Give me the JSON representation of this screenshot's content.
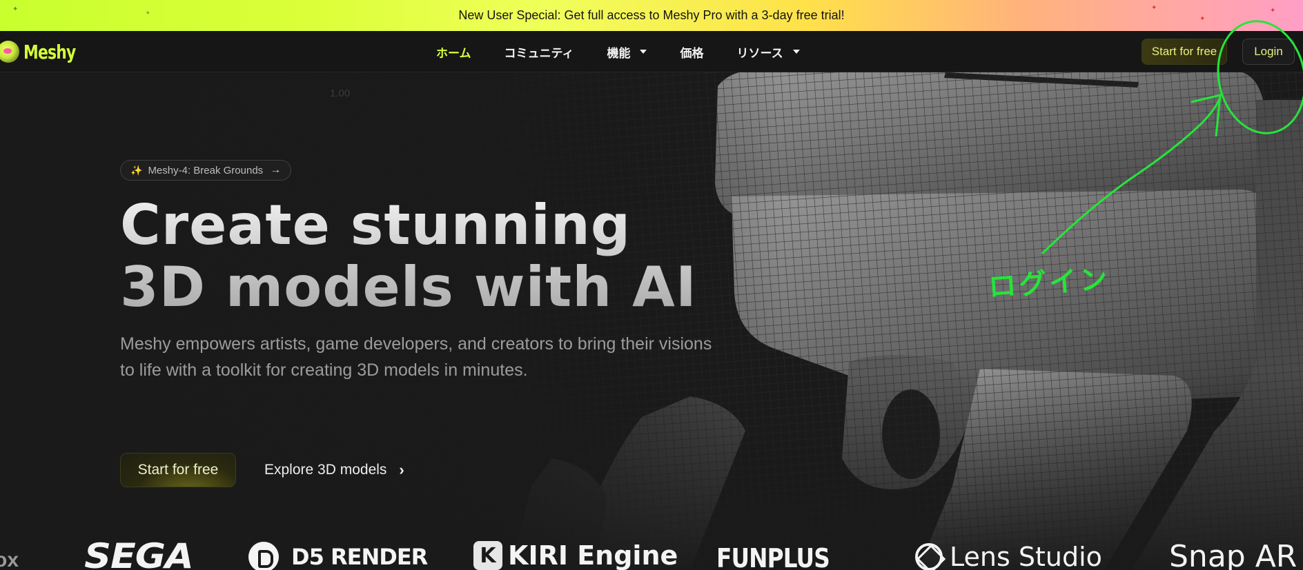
{
  "promo": {
    "text": "New User Special: Get full access to Meshy Pro with a 3-day free trial!"
  },
  "brand": {
    "name": "Meshy"
  },
  "nav": {
    "items": [
      {
        "label": "ホーム",
        "active": true,
        "dropdown": false
      },
      {
        "label": "コミュニティ",
        "active": false,
        "dropdown": false
      },
      {
        "label": "機能",
        "active": false,
        "dropdown": true
      },
      {
        "label": "価格",
        "active": false,
        "dropdown": false
      },
      {
        "label": "リソース",
        "active": false,
        "dropdown": true
      }
    ],
    "cta_label": "Start for free",
    "login_label": "Login"
  },
  "hero": {
    "faint_label": "1.00",
    "badge_label": "Meshy-4: Break Grounds",
    "headline_line1": "Create stunning",
    "headline_line2": "3D models with AI",
    "subtitle_line1": "Meshy empowers artists, game developers, and creators to bring their visions",
    "subtitle_line2": "to life with a toolkit for creating 3D models in minutes.",
    "cta_label": "Start for free",
    "explore_label": "Explore 3D models"
  },
  "logos": {
    "edge": "ox",
    "sega": "SEGA",
    "d5": "D5 RENDER",
    "kiri_mark": "K",
    "kiri": "KIRI Engine",
    "funplus": "FUNPLUS",
    "lens": "Lens Studio",
    "snap": "Snap AR"
  },
  "annotation": {
    "text": "ログイン",
    "color": "#27e43a"
  },
  "colors": {
    "accent": "#d7ff3a",
    "background": "#1a1a1a",
    "login_text": "#e6ee86"
  }
}
